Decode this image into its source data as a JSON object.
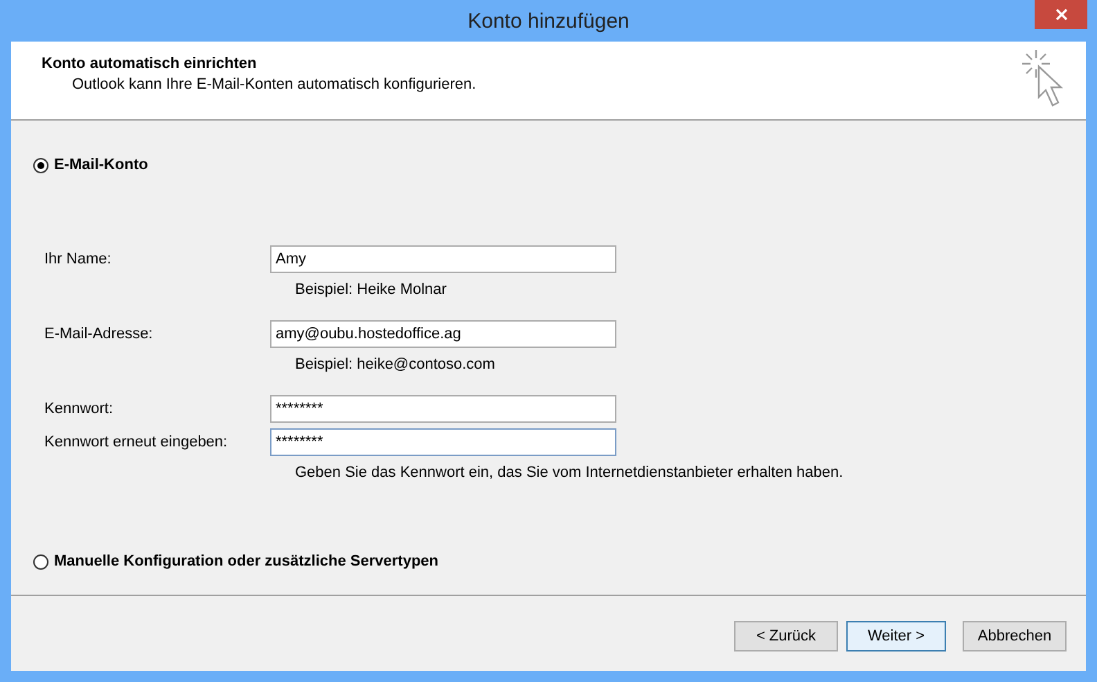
{
  "window": {
    "title": "Konto hinzufügen"
  },
  "header": {
    "title": "Konto automatisch einrichten",
    "subtitle": "Outlook kann Ihre E-Mail-Konten automatisch konfigurieren."
  },
  "options": [
    {
      "label": "E-Mail-Konto",
      "selected": true
    },
    {
      "label": "Manuelle Konfiguration oder zusätzliche Servertypen",
      "selected": false
    }
  ],
  "fields": [
    {
      "label": "Ihr Name:",
      "value": "Amy",
      "hint": "Beispiel: Heike Molnar",
      "focused": false
    },
    {
      "label": "E-Mail-Adresse:",
      "value": "amy@oubu.hostedoffice.ag",
      "hint": "Beispiel: heike@contoso.com",
      "focused": false
    },
    {
      "label": "Kennwort:",
      "value": "********",
      "focused": false
    },
    {
      "label": "Kennwort erneut eingeben:",
      "value": "********",
      "hint": "Geben Sie das Kennwort ein, das Sie vom Internetdienstanbieter erhalten haben.",
      "focused": true
    }
  ],
  "buttons": [
    {
      "label": "< Zurück",
      "default": false
    },
    {
      "label": "Weiter >",
      "default": true
    },
    {
      "label": "Abbrechen",
      "default": false
    }
  ]
}
